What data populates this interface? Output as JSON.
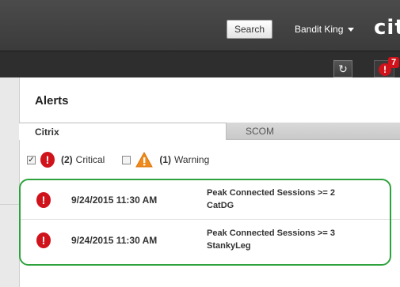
{
  "header": {
    "search_label": "Search",
    "user_name": "Bandit King",
    "brand": "citr",
    "notification_count": "7"
  },
  "panel": {
    "title": "Alerts",
    "tabs": [
      {
        "label": "Citrix",
        "active": true
      },
      {
        "label": "SCOM",
        "active": false
      }
    ],
    "filters": {
      "critical_count": "(2)",
      "critical_label": "Critical",
      "warning_count": "(1)",
      "warning_label": "Warning"
    },
    "alerts": [
      {
        "time": "9/24/2015 11:30 AM",
        "title": "Peak Connected Sessions >= 2",
        "target": "CatDG"
      },
      {
        "time": "9/24/2015 11:30 AM",
        "title": "Peak Connected Sessions >= 3",
        "target": "StankyLeg"
      }
    ]
  },
  "colors": {
    "critical": "#d0121b",
    "warning": "#f08a1c",
    "highlight": "#2ea33d",
    "topbar": "#3b3b3b"
  }
}
